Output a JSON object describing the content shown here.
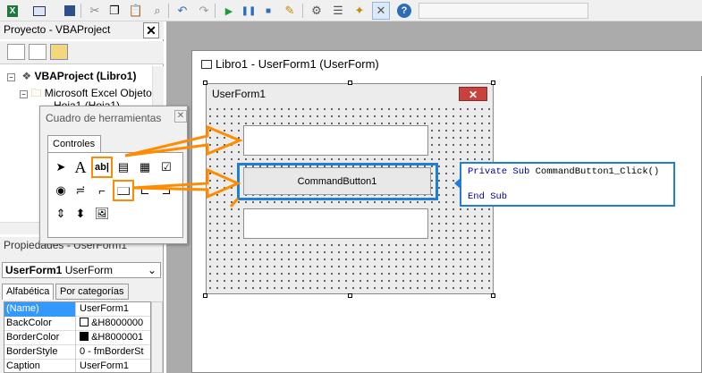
{
  "project_panel": {
    "title": "Proyecto - VBAProject",
    "tree": [
      {
        "label": "VBAProject (Libro1)"
      },
      {
        "label": "Microsoft Excel Objetos"
      },
      {
        "label": "Hoja1 (Hoja1)"
      }
    ]
  },
  "toolbox": {
    "title": "Cuadro de herramientas",
    "tab": "Controles",
    "label_tool_glyph": "A",
    "textbox_tool_glyph": "ab|"
  },
  "properties": {
    "title": "Propiedades - UserForm1",
    "object_name": "UserForm1",
    "object_type": "UserForm",
    "tabs": [
      "Alfabética",
      "Por categorías"
    ],
    "rows": [
      {
        "name": "(Name)",
        "value": "UserForm1"
      },
      {
        "name": "BackColor",
        "value": "&H8000000"
      },
      {
        "name": "BorderColor",
        "value": "&H8000001"
      },
      {
        "name": "BorderStyle",
        "value": "0 - fmBorderSt"
      },
      {
        "name": "Caption",
        "value": "UserForm1"
      }
    ]
  },
  "userform_window": {
    "title": "Libro1 - UserForm1 (UserForm)"
  },
  "form": {
    "caption": "UserForm1",
    "button_caption": "CommandButton1"
  },
  "code": {
    "line1_kw": "Private Sub",
    "line1_rest": " CommandButton1_Click()",
    "line2_kw": "End Sub"
  },
  "colors": {
    "highlight_orange": "#ff8c00",
    "highlight_blue": "#1e7fd8"
  }
}
